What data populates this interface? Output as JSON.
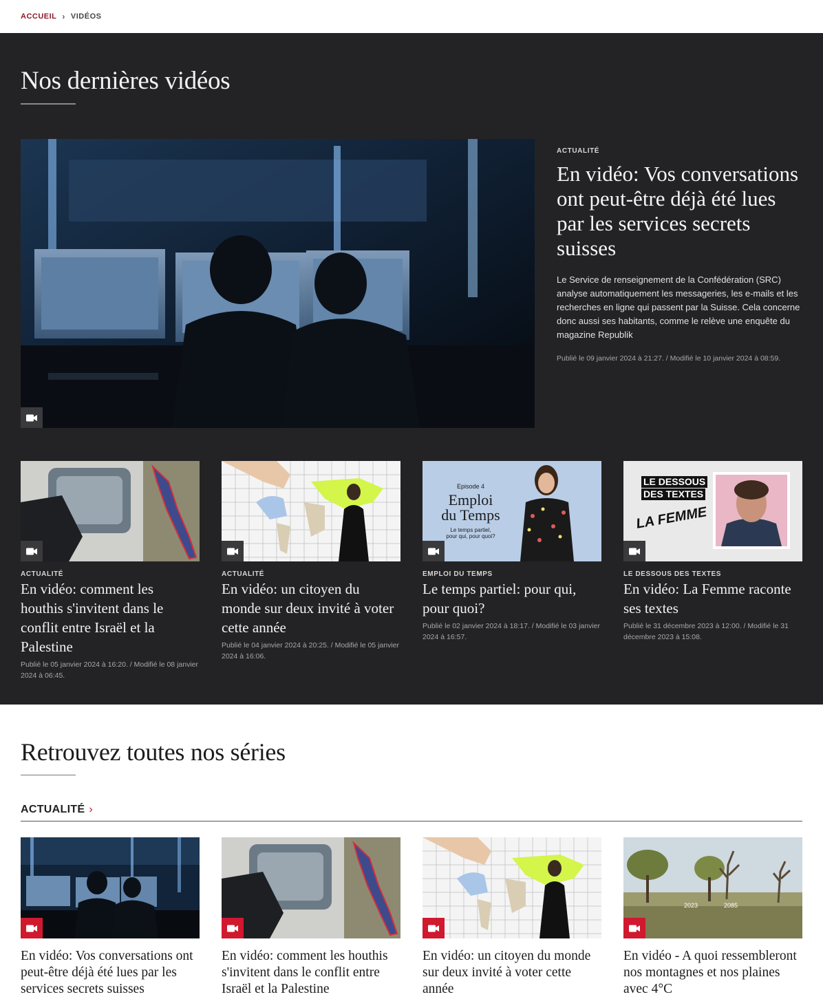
{
  "breadcrumb": {
    "home": "ACCUEIL",
    "current": "VIDÉOS"
  },
  "latest": {
    "heading": "Nos dernières vidéos",
    "hero": {
      "kicker": "ACTUALITÉ",
      "title": "En vidéo: Vos conversations ont peut-être déjà été lues par les services secrets suisses",
      "description": "Le Service de renseignement de la Confédération (SRC) analyse automatiquement les messageries, les e-mails et les recherches en ligne qui passent par la Suisse. Cela concerne donc aussi ses habitants, comme le relève une enquête du magazine Republik",
      "meta": "Publié le 09 janvier 2024 à 21:27. / Modifié le 10 janvier 2024 à 08:59.",
      "icon": "video-camera-icon"
    },
    "cards": [
      {
        "kicker": "ACTUALITÉ",
        "title": "En vidéo: comment les houthis s'invitent dans le conflit entre Israël et la Palestine",
        "meta": "Publié le 05 janvier 2024 à 16:20. / Modifié le 08 janvier 2024 à 06:45."
      },
      {
        "kicker": "ACTUALITÉ",
        "title": "En vidéo: un citoyen du monde sur deux invité à voter cette année",
        "meta": "Publié le 04 janvier 2024 à 20:25. / Modifié le 05 janvier 2024 à 16:06."
      },
      {
        "kicker": "EMPLOI DU TEMPS",
        "title": "Le temps partiel: pour qui, pour quoi?",
        "meta": "Publié le 02 janvier 2024 à 18:17. / Modifié le 03 janvier 2024 à 16:57.",
        "thumb_text": {
          "episode": "Episode 4",
          "title_line1": "Emploi",
          "title_line2": "du Temps",
          "sub1": "Le temps partiel,",
          "sub2": "pour qui, pour quoi?"
        }
      },
      {
        "kicker": "LE DESSOUS DES TEXTES",
        "title": "En vidéo: La Femme raconte ses textes",
        "meta": "Publié le 31 décembre 2023 à 12:00. / Modifié le 31 décembre 2023 à 15:08.",
        "thumb_text": {
          "line1": "LE DESSOUS",
          "line2": "DES TEXTES",
          "line3": "LA FEMME"
        }
      }
    ]
  },
  "series": {
    "heading": "Retrouvez toutes nos séries",
    "section_label": "ACTUALITÉ",
    "section_chevron": "›",
    "cards": [
      {
        "title": "En vidéo: Vos conversations ont peut-être déjà été lues par les services secrets suisses"
      },
      {
        "title": "En vidéo: comment les houthis s'invitent dans le conflit entre Israël et la Palestine"
      },
      {
        "title": "En vidéo: un citoyen du monde sur deux invité à voter cette année"
      },
      {
        "title": "En vidéo - A quoi ressembleront nos montagnes et nos plaines avec 4°C",
        "thumb_text": {
          "year1": "2023",
          "year2": "2085"
        }
      }
    ]
  },
  "colors": {
    "dark_bg": "#232325",
    "accent_red": "#d0182f",
    "breadcrumb_red": "#8b1a2b"
  }
}
